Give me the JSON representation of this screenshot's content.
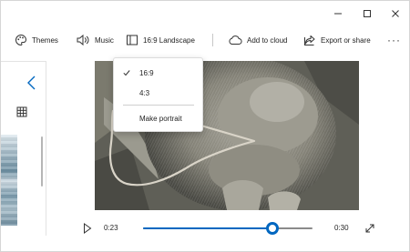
{
  "window_controls": {
    "minimize_icon": "minimize-icon",
    "maximize_icon": "maximize-icon",
    "close_icon": "close-icon"
  },
  "toolbar": {
    "themes_label": "Themes",
    "music_label": "Music",
    "aspect_label": "16:9 Landscape",
    "cloud_label": "Add to cloud",
    "export_label": "Export or share",
    "more_label": "···"
  },
  "aspect_menu": {
    "items": [
      {
        "label": "16:9",
        "checked": true
      },
      {
        "label": "4:3",
        "checked": false
      },
      {
        "label": "Make portrait",
        "checked": false
      }
    ]
  },
  "playback": {
    "current_time": "0:23",
    "total_time": "0:30",
    "progress_fraction": 0.766
  },
  "colors": {
    "accent": "#0067c0",
    "preview_bg": "#6b6b62"
  }
}
